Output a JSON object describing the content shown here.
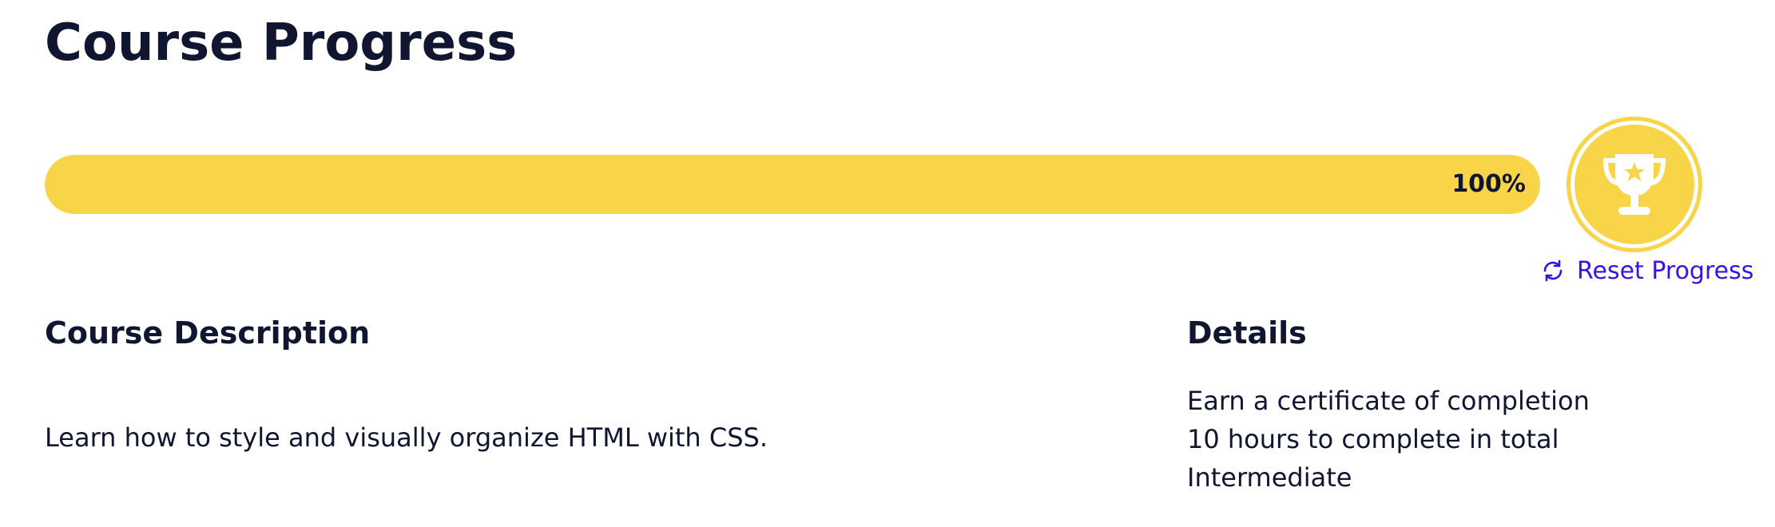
{
  "page": {
    "title": "Course Progress"
  },
  "progress": {
    "value": 1.0,
    "label": "100%",
    "fill_color": "#f8d548"
  },
  "badge": {
    "icon": "trophy-icon",
    "color": "#f8d548"
  },
  "reset": {
    "label": "Reset Progress",
    "icon": "refresh-icon",
    "color": "#3a10e5"
  },
  "description": {
    "heading": "Course Description",
    "text": "Learn how to style and visually organize HTML with CSS."
  },
  "details": {
    "heading": "Details",
    "items": [
      "Earn a certificate of completion",
      "10 hours to complete in total",
      "Intermediate"
    ]
  }
}
